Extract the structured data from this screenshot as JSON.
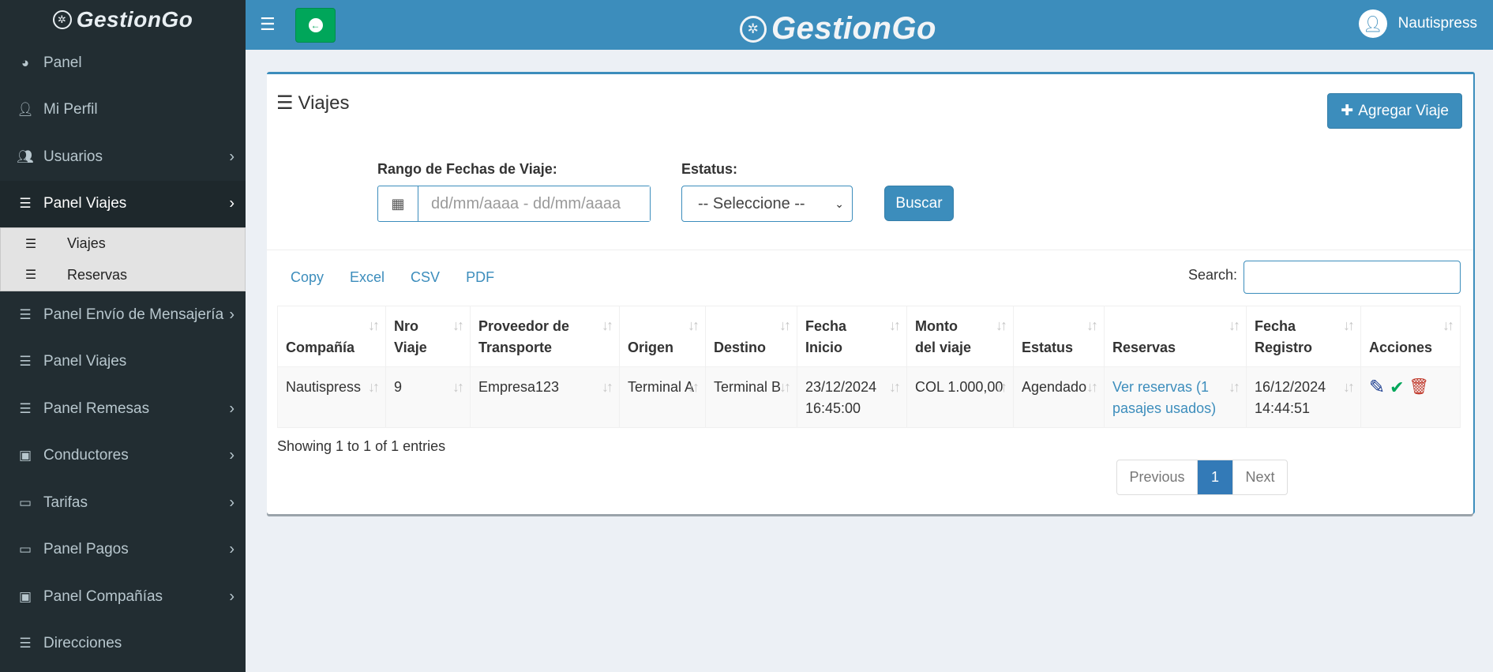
{
  "app": {
    "logo_text": "GestionGo"
  },
  "sidebar": {
    "items": [
      {
        "label": "Panel",
        "icon": "dashboard-icon"
      },
      {
        "label": "Mi Perfil",
        "icon": "user-icon"
      },
      {
        "label": "Usuarios",
        "icon": "users-icon"
      },
      {
        "label": "Panel Viajes",
        "icon": "list-icon"
      },
      {
        "label": "Panel Envío de Mensajería",
        "icon": "list-icon"
      },
      {
        "label": "Panel Viajes",
        "icon": "list-icon"
      },
      {
        "label": "Panel Remesas",
        "icon": "list-icon"
      },
      {
        "label": "Conductores",
        "icon": "briefcase-icon"
      },
      {
        "label": "Tarifas",
        "icon": "money-icon"
      },
      {
        "label": "Panel Pagos",
        "icon": "money-icon"
      },
      {
        "label": "Panel Compañías",
        "icon": "briefcase-icon"
      },
      {
        "label": "Direcciones",
        "icon": "list-icon"
      }
    ],
    "submenu": [
      {
        "label": "Viajes"
      },
      {
        "label": "Reservas"
      }
    ]
  },
  "header": {
    "user_name": "Nautispress"
  },
  "main": {
    "title": "Viajes",
    "add_button": "Agregar Viaje",
    "filters": {
      "date_label": "Rango de Fechas de Viaje:",
      "date_placeholder": "dd/mm/aaaa - dd/mm/aaaa",
      "status_label": "Estatus:",
      "status_selected": "-- Seleccione --",
      "search_button": "Buscar"
    },
    "export": [
      "Copy",
      "Excel",
      "CSV",
      "PDF"
    ],
    "search_label": "Search:",
    "table": {
      "headers": [
        [
          "Compañía"
        ],
        [
          "Nro",
          "Viaje"
        ],
        [
          "Proveedor de",
          "Transporte"
        ],
        [
          "Origen"
        ],
        [
          "Destino"
        ],
        [
          "Fecha",
          "Inicio"
        ],
        [
          "Monto",
          "del viaje"
        ],
        [
          "Estatus"
        ],
        [
          "Reservas"
        ],
        [
          "Fecha",
          "Registro"
        ],
        [
          "Acciones"
        ]
      ],
      "rows": [
        {
          "compania": "Nautispress",
          "nro": "9",
          "proveedor": "Empresa123",
          "origen": "Terminal A",
          "destino": "Terminal B",
          "fecha_inicio": [
            "23/12/2024",
            "16:45:00"
          ],
          "monto": "COL 1.000,00",
          "estatus": "Agendado",
          "reservas": [
            "Ver reservas (1",
            "pasajes usados)"
          ],
          "fecha_registro": [
            "16/12/2024",
            "14:44:51"
          ]
        }
      ]
    },
    "showing": "Showing 1 to 1 of 1 entries",
    "pagination": {
      "previous": "Previous",
      "current": "1",
      "next": "Next"
    }
  },
  "colors": {
    "primary": "#3c8dbc",
    "sidebar_bg": "#222d32",
    "success": "#00a65a",
    "danger": "#c0392b"
  }
}
